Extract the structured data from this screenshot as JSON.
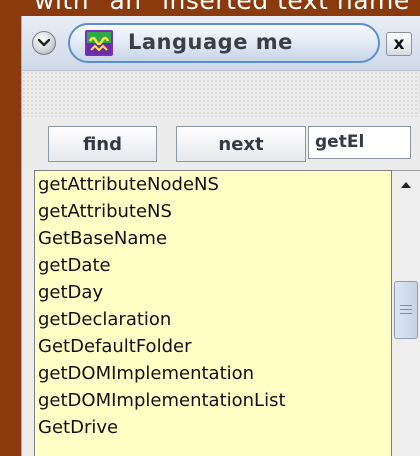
{
  "caption": "with \"an\" inserted text name",
  "window": {
    "title": "Language me",
    "menu_icon": "chevron-down-icon",
    "app_icon": "sil-logo-icon",
    "close_label": "x"
  },
  "toolbar": {
    "find_label": "find",
    "next_label": "next",
    "search_value": "getEl"
  },
  "list": {
    "items": [
      "getAttributeNodeNS",
      "getAttributeNS",
      "GetBaseName",
      "getDate",
      "getDay",
      "getDeclaration",
      "GetDefaultFolder",
      "getDOMImplementation",
      "getDOMImplementationList",
      "GetDrive"
    ]
  },
  "colors": {
    "list_background": "#ffffc6",
    "frame_background": "#8a3a0c",
    "title_border": "#5b8fcf"
  }
}
